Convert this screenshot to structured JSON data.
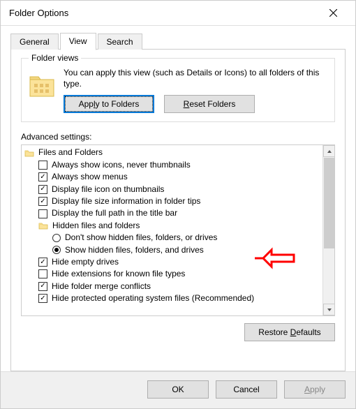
{
  "window": {
    "title": "Folder Options"
  },
  "tabs": [
    {
      "label": "General"
    },
    {
      "label": "View"
    },
    {
      "label": "Search"
    }
  ],
  "folderViews": {
    "legend": "Folder views",
    "description": "You can apply this view (such as Details or Icons) to all folders of this type.",
    "applyButton": "Apply to Folders",
    "resetButton": "Reset Folders"
  },
  "advanced": {
    "label": "Advanced settings:",
    "rootLabel": "Files and Folders",
    "items": [
      {
        "label": "Always show icons, never thumbnails",
        "checked": false
      },
      {
        "label": "Always show menus",
        "checked": true
      },
      {
        "label": "Display file icon on thumbnails",
        "checked": true
      },
      {
        "label": "Display file size information in folder tips",
        "checked": true
      },
      {
        "label": "Display the full path in the title bar",
        "checked": false
      }
    ],
    "hiddenGroup": {
      "label": "Hidden files and folders",
      "options": [
        {
          "label": "Don't show hidden files, folders, or drives",
          "checked": false
        },
        {
          "label": "Show hidden files, folders, and drives",
          "checked": true
        }
      ]
    },
    "itemsAfter": [
      {
        "label": "Hide empty drives",
        "checked": true
      },
      {
        "label": "Hide extensions for known file types",
        "checked": false
      },
      {
        "label": "Hide folder merge conflicts",
        "checked": true
      },
      {
        "label": "Hide protected operating system files (Recommended)",
        "checked": true
      }
    ]
  },
  "buttons": {
    "restoreDefaults": "Restore Defaults",
    "ok": "OK",
    "cancel": "Cancel",
    "apply": "Apply"
  },
  "accessKeys": {
    "applyToFolders": "l",
    "resetFolders": "R",
    "restoreDefaults": "D",
    "apply": "A"
  },
  "annotation": {
    "color": "#ff0000",
    "target": "Show hidden files, folders, and drives"
  }
}
